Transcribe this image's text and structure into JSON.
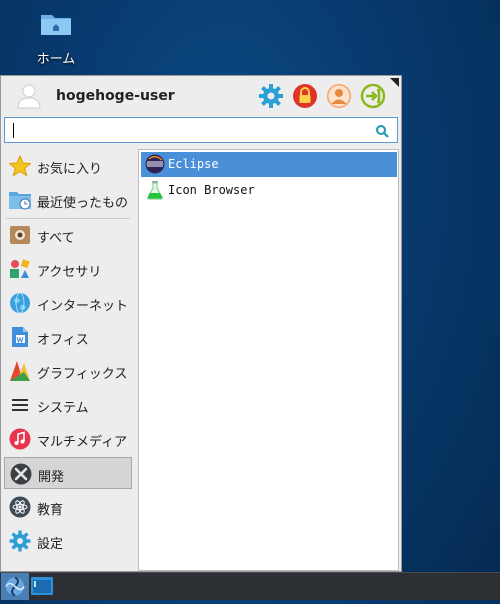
{
  "desktop": {
    "home_label": "ホーム"
  },
  "menu": {
    "username": "hogehoge-user",
    "search": {
      "value": "",
      "placeholder": ""
    },
    "categories": [
      {
        "label": "お気に入り",
        "icon": "star-icon"
      },
      {
        "label": "最近使ったもの",
        "icon": "recent-folder-icon"
      },
      {
        "label": "すべて",
        "icon": "all-apps-icon"
      },
      {
        "label": "アクセサリ",
        "icon": "accessories-icon"
      },
      {
        "label": "インターネット",
        "icon": "internet-globe-icon"
      },
      {
        "label": "オフィス",
        "icon": "office-doc-icon"
      },
      {
        "label": "グラフィックス",
        "icon": "graphics-icon"
      },
      {
        "label": "システム",
        "icon": "system-menu-icon"
      },
      {
        "label": "マルチメディア",
        "icon": "music-note-icon"
      },
      {
        "label": "開発",
        "icon": "development-tools-icon"
      },
      {
        "label": "教育",
        "icon": "education-atom-icon"
      },
      {
        "label": "設定",
        "icon": "settings-gear-icon"
      }
    ],
    "active_category": "開発",
    "apps": [
      {
        "label": "Eclipse",
        "icon": "eclipse-icon",
        "selected": true
      },
      {
        "label": "Icon Browser",
        "icon": "flask-icon",
        "selected": false
      }
    ]
  },
  "colors": {
    "selection": "#4a90d9",
    "accent_gear": "#2a9fd6",
    "lock": "#e0342a",
    "logout": "#8ab81a"
  }
}
